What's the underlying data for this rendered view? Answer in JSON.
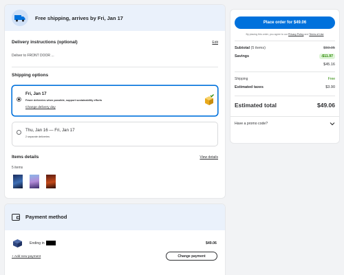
{
  "shipping": {
    "header": "Free shipping, arrives by Fri, Jan 17",
    "delivery_title": "Delivery instructions (optional)",
    "edit_label": "Edit",
    "delivery_text": "Deliver to FRONT DOOR ...",
    "options_title": "Shipping options",
    "option1": {
      "date": "Fri, Jan 17",
      "desc": "Fewer deliveries when possible, support sustainability efforts",
      "change_label": "Change delivery day"
    },
    "option2": {
      "date": "Thu, Jan 16 — Fri, Jan 17",
      "desc": "2 separate deliveries"
    }
  },
  "items": {
    "title": "Items details",
    "view_label": "View details",
    "count": "5 items"
  },
  "payment": {
    "title": "Payment method",
    "ending_label": "Ending in",
    "amount": "$49.06",
    "add_label": "+ Add new payment",
    "change_label": "Change payment"
  },
  "summary": {
    "place_order": "Place order for $49.06",
    "terms_prefix": "By placing this order, you agree to our ",
    "privacy_label": "Privacy Policy",
    "terms_and": " and ",
    "terms_label": "Terms of Use",
    "subtotal_label": "Subtotal",
    "subtotal_items": "(5 items)",
    "subtotal_value": "$59.95",
    "savings_label": "Savings",
    "savings_value": "-$11.97",
    "net_value": "$45.16",
    "shipping_label": "Shipping",
    "shipping_value": "Free",
    "taxes_label": "Estimated taxes",
    "taxes_value": "$3.90",
    "total_label": "Estimated total",
    "total_value": "$49.06",
    "promo_label": "Have a promo code?"
  },
  "colors": {
    "accent": "#0071dc",
    "savings_green": "#2a8703",
    "header_bg": "#eaf1fb"
  },
  "icons": [
    "truck-icon",
    "delivery-box-icon",
    "wallet-icon",
    "card-icon",
    "chevron-down-icon"
  ]
}
